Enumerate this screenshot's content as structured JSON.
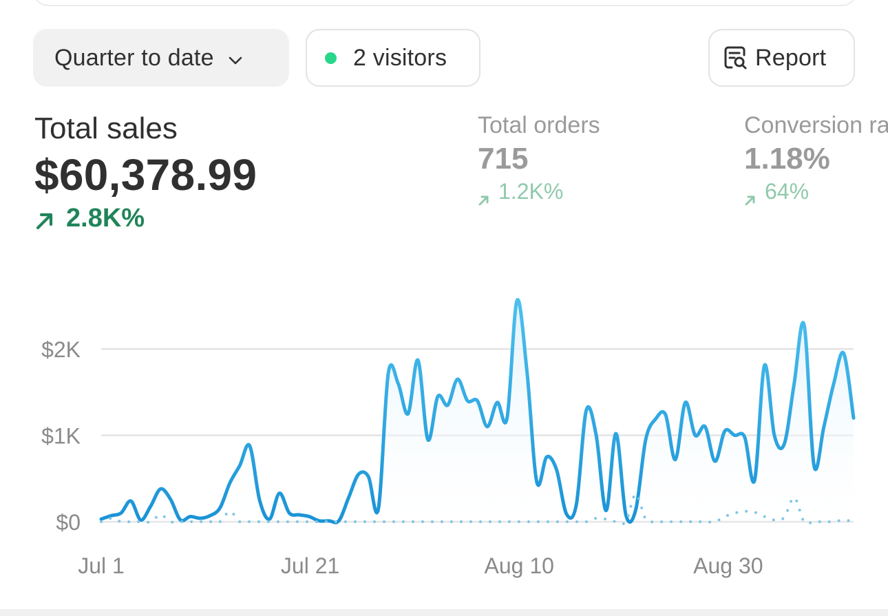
{
  "toolbar": {
    "range_label": "Quarter to date",
    "visitors_label": "2 visitors",
    "report_label": "Report"
  },
  "icons": {
    "range_dropdown": "chevron-down-icon",
    "visitors_status": "live-dot-icon",
    "report": "report-search-icon",
    "trend": "arrow-up-right-icon"
  },
  "colors": {
    "line": "#1ea1e0",
    "line_light": "#4cc0ee",
    "comparison": "#7fc6e6",
    "positive": "#21845a",
    "positive_muted": "#90c9ac",
    "live_dot": "#29d68b"
  },
  "metrics": {
    "total_sales": {
      "label": "Total sales",
      "value": "$60,378.99",
      "change": "2.8K%"
    },
    "total_orders": {
      "label": "Total orders",
      "value": "715",
      "change": "1.2K%"
    },
    "conversion": {
      "label": "Conversion rate",
      "value": "1.18%",
      "change": "64%"
    }
  },
  "chart_data": {
    "type": "area",
    "x_tick_labels": [
      "Jul 1",
      "Jul 21",
      "Aug 10",
      "Aug 30"
    ],
    "y_tick_labels": [
      "$0",
      "$1K",
      "$2K"
    ],
    "y_ticks": [
      0,
      1000,
      2000
    ],
    "ylim": [
      0,
      2700
    ],
    "xlim": [
      0,
      72
    ],
    "x_ticks": [
      0,
      20,
      40,
      60
    ],
    "grid": true,
    "series": [
      {
        "style": "solid",
        "values": [
          30,
          70,
          100,
          240,
          20,
          180,
          380,
          260,
          20,
          60,
          40,
          70,
          160,
          450,
          650,
          880,
          250,
          30,
          330,
          100,
          80,
          60,
          10,
          10,
          10,
          280,
          550,
          520,
          150,
          1720,
          1600,
          1250,
          1870,
          950,
          1450,
          1350,
          1650,
          1400,
          1400,
          1100,
          1380,
          1200,
          2560,
          1750,
          460,
          750,
          600,
          90,
          200,
          1290,
          1000,
          130,
          1020,
          80,
          140,
          950,
          1190,
          1240,
          720,
          1380,
          1000,
          1100,
          700,
          1050,
          1000,
          980,
          480,
          1810,
          1000,
          900,
          1600,
          2280,
          650,
          1100,
          1600,
          1950,
          1200
        ]
      },
      {
        "style": "dotted",
        "values": [
          0,
          40,
          0,
          0,
          0,
          0,
          80,
          0,
          0,
          0,
          0,
          0,
          0,
          120,
          0,
          0,
          0,
          0,
          0,
          0,
          0,
          0,
          0,
          0,
          0,
          0,
          0,
          0,
          0,
          0,
          0,
          0,
          0,
          0,
          0,
          0,
          0,
          0,
          0,
          0,
          0,
          0,
          0,
          0,
          0,
          0,
          0,
          0,
          0,
          0,
          40,
          30,
          0,
          0,
          320,
          30,
          0,
          0,
          0,
          0,
          0,
          0,
          0,
          60,
          100,
          120,
          110,
          60,
          20,
          50,
          280,
          0,
          0,
          0,
          0,
          20,
          0
        ]
      }
    ]
  }
}
